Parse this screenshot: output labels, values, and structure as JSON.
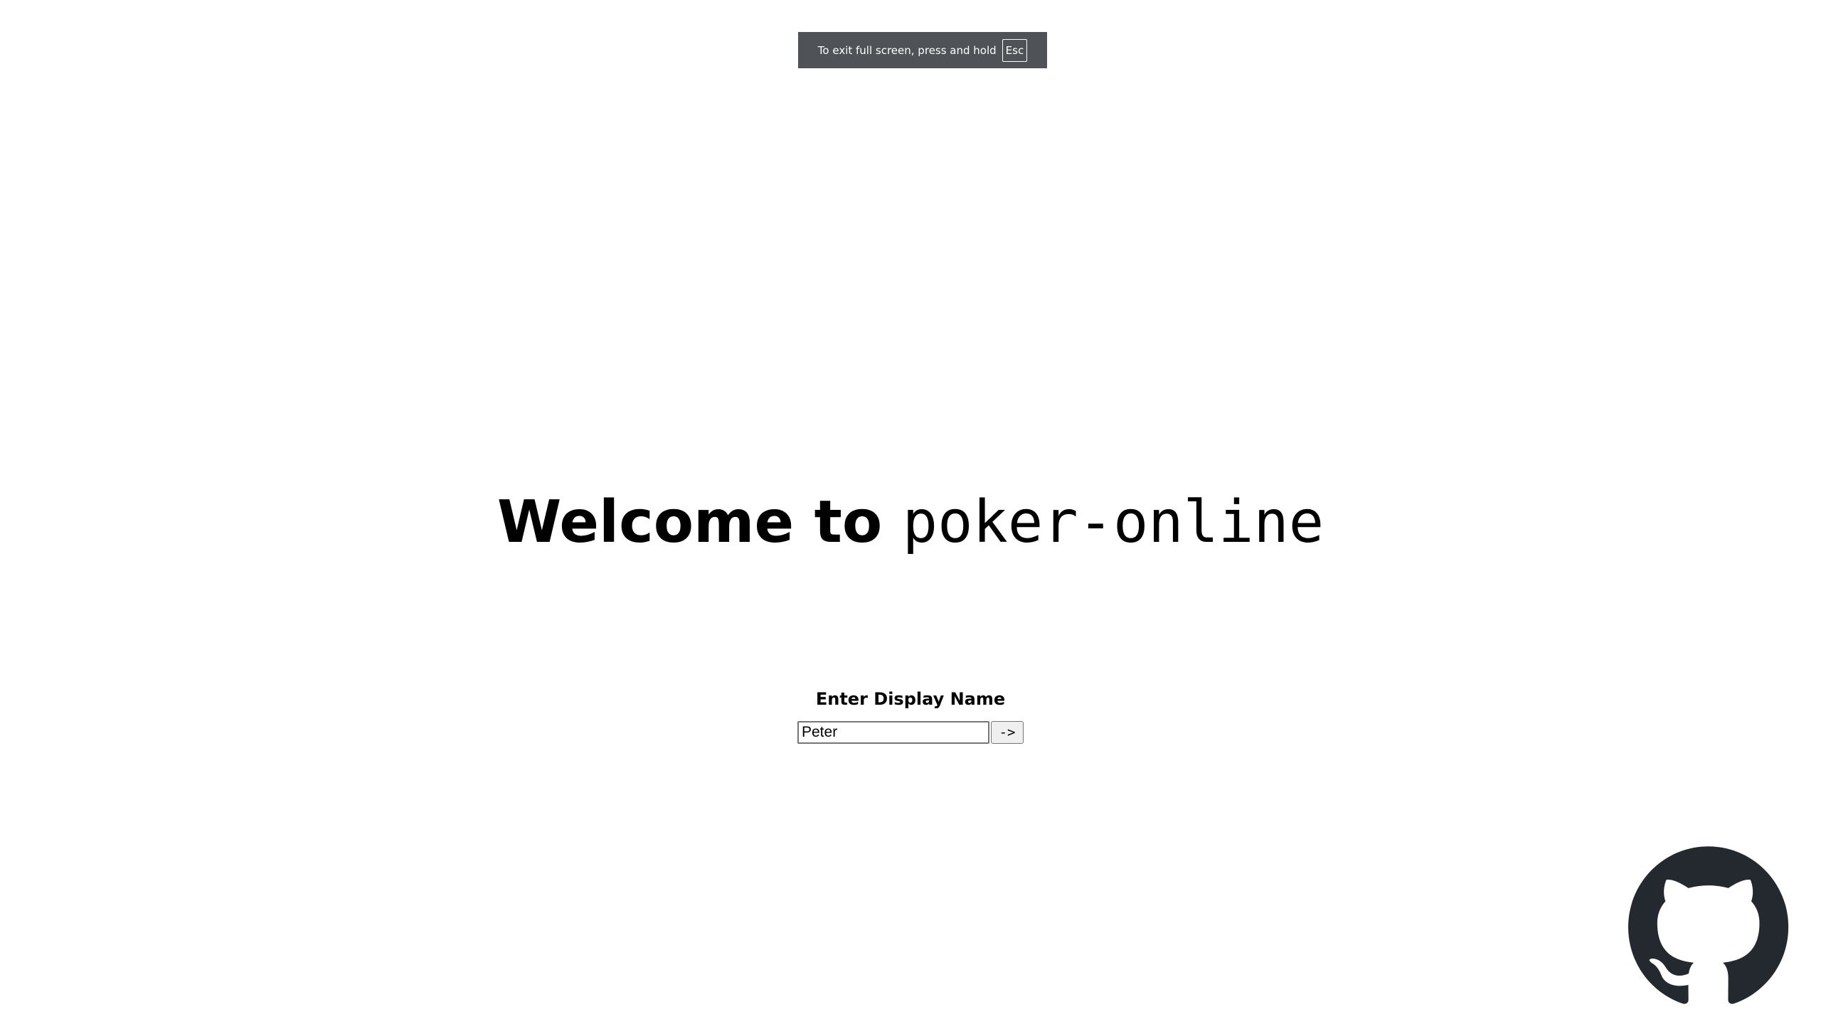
{
  "fullscreen_banner": {
    "message": "To exit full screen, press and hold",
    "key_label": "Esc"
  },
  "heading": {
    "prefix": "Welcome to ",
    "app_name": "poker-online"
  },
  "name_form": {
    "label": "Enter Display Name",
    "input_value": "Peter",
    "submit_label": "->"
  },
  "github_link": {
    "icon": "github-icon",
    "color": "#24292f"
  }
}
